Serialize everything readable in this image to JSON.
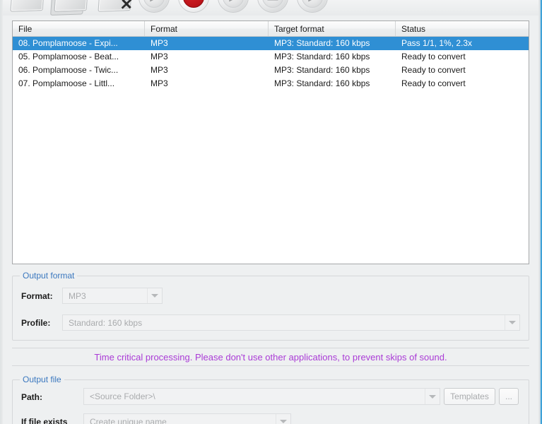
{
  "toolbar": {
    "buttons": [
      {
        "name": "add-files-button",
        "icon": "folder-icon",
        "glyph": ""
      },
      {
        "name": "add-folder-button",
        "icon": "folder-stack-icon",
        "glyph": ""
      },
      {
        "name": "remove-files-button",
        "icon": "folder-remove-icon",
        "glyph": "✕"
      },
      {
        "name": "start-button",
        "icon": "play-circle-icon",
        "glyph": "▶"
      },
      {
        "name": "stop-button",
        "icon": "stop-circle-icon",
        "glyph": "✋"
      },
      {
        "name": "resume-button",
        "icon": "play-circle-icon",
        "glyph": "▶"
      },
      {
        "name": "pause-button",
        "icon": "pause-circle-icon",
        "glyph": "—"
      },
      {
        "name": "next-button",
        "icon": "play-circle-icon",
        "glyph": "▶"
      }
    ]
  },
  "file_list": {
    "columns": [
      "File",
      "Format",
      "Target format",
      "Status"
    ],
    "rows": [
      {
        "file": "08. Pomplamoose - Expi...",
        "format": "MP3",
        "target": "MP3: Standard: 160 kbps",
        "status": "Pass 1/1, 1%, 2.3x",
        "selected": true
      },
      {
        "file": "05. Pomplamoose - Beat...",
        "format": "MP3",
        "target": "MP3: Standard: 160 kbps",
        "status": "Ready to convert",
        "selected": false
      },
      {
        "file": "06. Pomplamoose - Twic...",
        "format": "MP3",
        "target": "MP3: Standard: 160 kbps",
        "status": "Ready to convert",
        "selected": false
      },
      {
        "file": "07. Pomplamoose - Littl...",
        "format": "MP3",
        "target": "MP3: Standard: 160 kbps",
        "status": "Ready to convert",
        "selected": false
      }
    ]
  },
  "output_format": {
    "group_title": "Output format",
    "format_label": "Format:",
    "format_value": "MP3",
    "profile_label": "Profile:",
    "profile_value": "Standard: 160 kbps"
  },
  "warning": {
    "text": "Time critical processing. Please don't use other applications, to prevent skips of sound."
  },
  "output_file": {
    "group_title": "Output file",
    "path_label": "Path:",
    "path_value": "<Source Folder>\\",
    "templates_label": "Templates",
    "browse_label": "...",
    "if_exists_label": "If file exists",
    "if_exists_value": "Create unique name"
  },
  "colors": {
    "selection_blue": "#2f8fd4",
    "group_title_blue": "#3b78bf",
    "warning_purple": "#aa3bd6",
    "window_edge_blue": "#3ea6dd",
    "stop_red": "#bc1319"
  }
}
